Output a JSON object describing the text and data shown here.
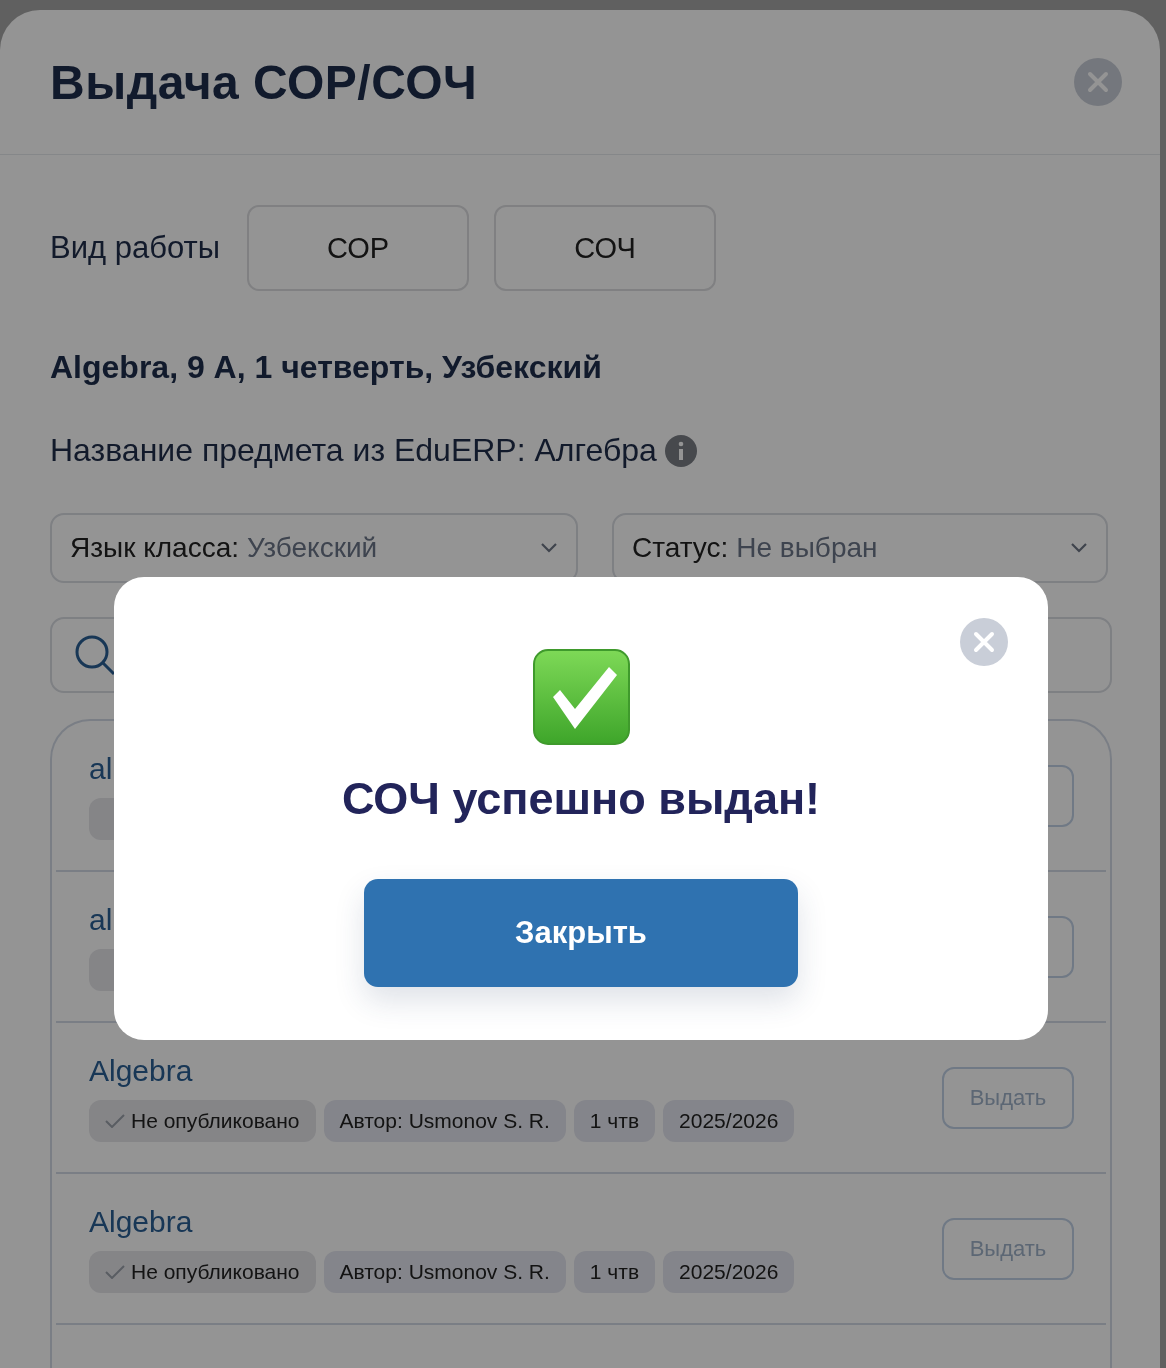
{
  "dialog": {
    "title": "Выдача СОР/СОЧ",
    "work_type": {
      "label": "Вид работы",
      "options": [
        {
          "label": "СОР",
          "selected": false
        },
        {
          "label": "СОЧ",
          "selected": false
        }
      ]
    },
    "subject": "Algebra, 9 А, 1 четверть, Узбекский",
    "erp_name": "Название предмета из EduERP: Алгебра",
    "filters": [
      {
        "label": "Язык класса:",
        "value": "Узбекский"
      },
      {
        "label": "Статус:",
        "value": "Не выбран"
      }
    ],
    "items": [
      {
        "title": "al"
      },
      {
        "title": "al"
      },
      {
        "title": "Algebra",
        "status": "Не опубликовано",
        "chips": [
          "Автор: Usmonov S. R.",
          "1 чтв",
          "2025/2026"
        ],
        "action": "Выдать"
      },
      {
        "title": "Algebra",
        "status": "Не опубликовано",
        "chips": [
          "Автор: Usmonov S. R.",
          "1 чтв",
          "2025/2026"
        ],
        "action": "Выдать"
      }
    ]
  },
  "popup": {
    "message": "СОЧ успешно выдан!",
    "button": "Закрыть"
  }
}
